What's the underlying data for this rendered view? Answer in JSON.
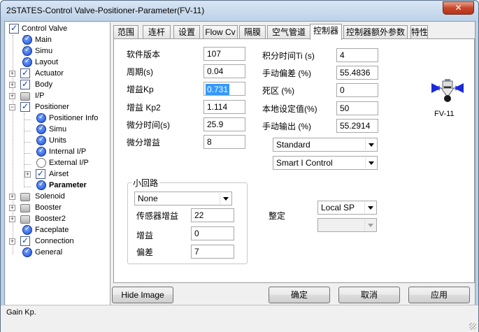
{
  "window": {
    "title": "2STATES-Control Valve-Positioner-Parameter(FV-11)"
  },
  "tree": {
    "items": [
      {
        "label": "Control Valve"
      },
      {
        "label": "Main"
      },
      {
        "label": "Simu"
      },
      {
        "label": "Layout"
      },
      {
        "label": "Actuator"
      },
      {
        "label": "Body"
      },
      {
        "label": "I/P"
      },
      {
        "label": "Positioner"
      },
      {
        "label": "Positioner Info"
      },
      {
        "label": "Simu"
      },
      {
        "label": "Units"
      },
      {
        "label": "Internal I/P"
      },
      {
        "label": "External I/P"
      },
      {
        "label": "Airset"
      },
      {
        "label": "Parameter"
      },
      {
        "label": "Solenoid"
      },
      {
        "label": "Booster"
      },
      {
        "label": "Booster2"
      },
      {
        "label": "Faceplate"
      },
      {
        "label": "Connection"
      },
      {
        "label": "General"
      }
    ]
  },
  "tabs": [
    "范围",
    "连杆",
    "设置",
    "Flow Cv",
    "隔膜",
    "空气管道",
    "控制器",
    "控制器额外参数",
    "特性"
  ],
  "active_tab": "控制器",
  "left_fields": [
    {
      "label": "软件版本",
      "value": "107"
    },
    {
      "label": "周期(s)",
      "value": "0.04"
    },
    {
      "label": "增益Kp",
      "value": "0.731"
    },
    {
      "label": "增益 Kp2",
      "value": "1.114"
    },
    {
      "label": "微分时间(s)",
      "value": "25.9"
    },
    {
      "label": "微分增益",
      "value": "8"
    }
  ],
  "right_fields": [
    {
      "label": "积分时间Ti (s)",
      "value": "4"
    },
    {
      "label": "手动偏差 (%)",
      "value": "55.4836"
    },
    {
      "label": "死区 (%)",
      "value": "0"
    },
    {
      "label": "本地设定值(%)",
      "value": "50"
    },
    {
      "label": "手动输出 (%)",
      "value": "55.2914"
    }
  ],
  "mode_select": "Standard",
  "control_select": "Smart I Control",
  "small_loop": {
    "title": "小回路",
    "select": "None",
    "fields": [
      {
        "label": "传感器增益",
        "value": "22"
      },
      {
        "label": "增益",
        "value": "0"
      },
      {
        "label": "偏差",
        "value": "7"
      }
    ]
  },
  "tuning": {
    "label": "整定",
    "select": "Local SP",
    "select2": ""
  },
  "valve_tag": "FV-11",
  "buttons": {
    "hide_image": "Hide Image",
    "ok": "确定",
    "cancel": "取消",
    "apply": "应用"
  },
  "status": "Gain Kp.",
  "colors": {
    "selection": "#3399ff",
    "check": "#0a3fa8",
    "valve_red": "#d01818",
    "valve_blue": "#1a2ad8"
  }
}
